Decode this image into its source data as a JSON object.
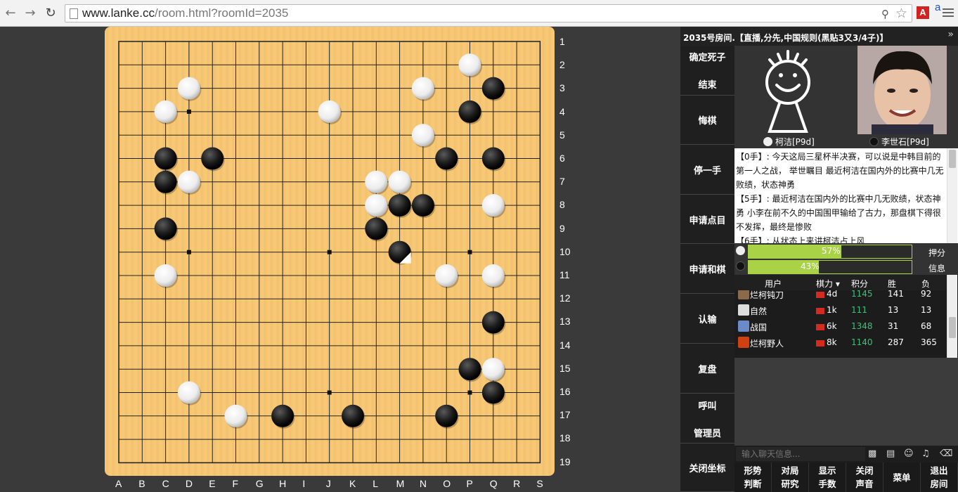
{
  "browser": {
    "url_host": "www.lanke.cc",
    "url_path": "/room.html?roomId=2035"
  },
  "room": {
    "title": "2035号房间.【直播,分先,中国规则(黑贴3又3/4子)】"
  },
  "actions": [
    {
      "lines": [
        "确定死子",
        "结束"
      ]
    },
    {
      "lines": [
        "悔棋"
      ]
    },
    {
      "lines": [
        "停一手"
      ]
    },
    {
      "lines": [
        "申请点目"
      ]
    },
    {
      "lines": [
        "申请和棋"
      ]
    },
    {
      "lines": [
        "认输"
      ]
    },
    {
      "lines": [
        "复盘"
      ]
    },
    {
      "lines": [
        "呼叫",
        "管理员"
      ]
    },
    {
      "lines": [
        "关闭坐标"
      ]
    }
  ],
  "players": {
    "white": {
      "name": "柯洁[P9d]"
    },
    "black": {
      "name": "李世石[P9d]"
    }
  },
  "commentary": [
    "【0手】: 今天这局三星杯半决赛，可以说是中韩目前的第一人之战， 举世瞩目 最近柯洁在国内外的比赛中几无败绩，状态神勇",
    "【5手】: 最近柯洁在国内外的比赛中几无败绩，状态神勇 小李在前不久的中国围甲输给了古力，那盘棋下得很不发挥，最终是惨败",
    "【6手】: 从状态上来讲柯洁占上风"
  ],
  "estimate": {
    "white_percent": 57,
    "black_percent": 43,
    "white_label": "57%",
    "black_label": "43%",
    "label_1": "押分",
    "label_2": "信息"
  },
  "users": {
    "headers": {
      "user": "用户",
      "rank": "棋力",
      "score": "积分",
      "win": "胜",
      "loss": "负"
    },
    "rows": [
      {
        "name": "烂柯钝刀",
        "rank": "4d",
        "score": "1145",
        "win": "141",
        "loss": "92"
      },
      {
        "name": "自然",
        "rank": "1k",
        "score": "111",
        "win": "13",
        "loss": "13"
      },
      {
        "name": "战国",
        "rank": "6k",
        "score": "1348",
        "win": "31",
        "loss": "68"
      },
      {
        "name": "烂柯野人",
        "rank": "8k",
        "score": "1140",
        "win": "287",
        "loss": "365"
      }
    ]
  },
  "chat": {
    "placeholder": "输入聊天信息..."
  },
  "bottom_tools": [
    {
      "lines": [
        "形势",
        "判断"
      ]
    },
    {
      "lines": [
        "对局",
        "研究"
      ]
    },
    {
      "lines": [
        "显示",
        "手数"
      ]
    },
    {
      "lines": [
        "关闭",
        "声音"
      ]
    },
    {
      "lines": [
        "菜单"
      ]
    },
    {
      "lines": [
        "退出",
        "房间"
      ]
    }
  ],
  "board": {
    "size": 19,
    "column_labels": [
      "A",
      "B",
      "C",
      "D",
      "E",
      "F",
      "G",
      "H",
      "I",
      "J",
      "K",
      "L",
      "M",
      "N",
      "O",
      "P",
      "Q",
      "R",
      "S"
    ],
    "row_labels": [
      "1",
      "2",
      "3",
      "4",
      "5",
      "6",
      "7",
      "8",
      "9",
      "10",
      "11",
      "12",
      "13",
      "14",
      "15",
      "16",
      "17",
      "18",
      "19"
    ],
    "last_move": {
      "col": "M",
      "row": 10
    },
    "stones": [
      {
        "col": "P",
        "row": 2,
        "color": "white"
      },
      {
        "col": "D",
        "row": 3,
        "color": "white"
      },
      {
        "col": "N",
        "row": 3,
        "color": "white"
      },
      {
        "col": "Q",
        "row": 3,
        "color": "black"
      },
      {
        "col": "C",
        "row": 4,
        "color": "white"
      },
      {
        "col": "J",
        "row": 4,
        "color": "white"
      },
      {
        "col": "P",
        "row": 4,
        "color": "black"
      },
      {
        "col": "N",
        "row": 5,
        "color": "white"
      },
      {
        "col": "C",
        "row": 6,
        "color": "black"
      },
      {
        "col": "E",
        "row": 6,
        "color": "black"
      },
      {
        "col": "O",
        "row": 6,
        "color": "black"
      },
      {
        "col": "Q",
        "row": 6,
        "color": "black"
      },
      {
        "col": "C",
        "row": 7,
        "color": "black"
      },
      {
        "col": "D",
        "row": 7,
        "color": "white"
      },
      {
        "col": "L",
        "row": 7,
        "color": "white"
      },
      {
        "col": "M",
        "row": 7,
        "color": "white"
      },
      {
        "col": "L",
        "row": 8,
        "color": "white"
      },
      {
        "col": "M",
        "row": 8,
        "color": "black"
      },
      {
        "col": "N",
        "row": 8,
        "color": "black"
      },
      {
        "col": "Q",
        "row": 8,
        "color": "white"
      },
      {
        "col": "C",
        "row": 9,
        "color": "black"
      },
      {
        "col": "L",
        "row": 9,
        "color": "black"
      },
      {
        "col": "M",
        "row": 10,
        "color": "black"
      },
      {
        "col": "C",
        "row": 11,
        "color": "white"
      },
      {
        "col": "O",
        "row": 11,
        "color": "white"
      },
      {
        "col": "Q",
        "row": 11,
        "color": "white"
      },
      {
        "col": "Q",
        "row": 13,
        "color": "black"
      },
      {
        "col": "P",
        "row": 15,
        "color": "black"
      },
      {
        "col": "Q",
        "row": 15,
        "color": "white"
      },
      {
        "col": "D",
        "row": 16,
        "color": "white"
      },
      {
        "col": "Q",
        "row": 16,
        "color": "black"
      },
      {
        "col": "F",
        "row": 17,
        "color": "white"
      },
      {
        "col": "H",
        "row": 17,
        "color": "black"
      },
      {
        "col": "K",
        "row": 17,
        "color": "black"
      },
      {
        "col": "O",
        "row": 17,
        "color": "black"
      }
    ]
  }
}
